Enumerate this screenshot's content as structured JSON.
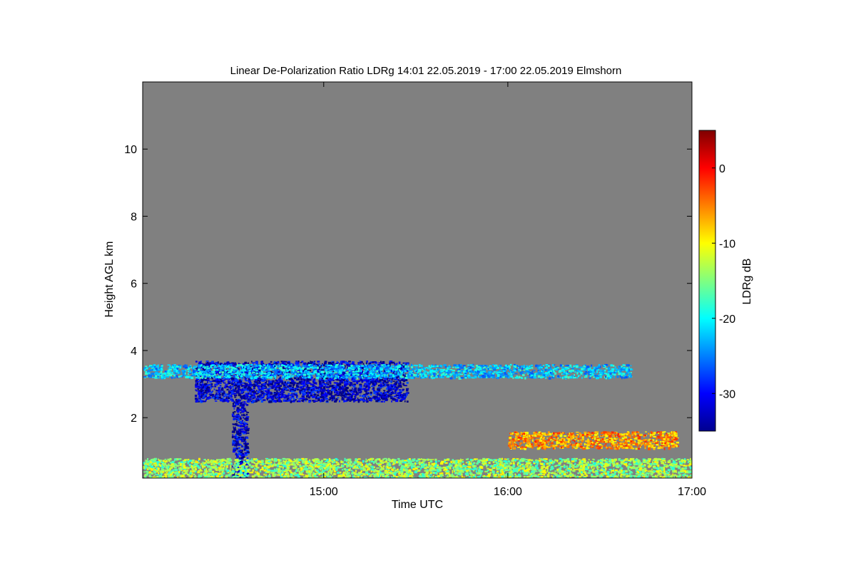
{
  "chart_data": {
    "type": "heatmap",
    "title": "Linear De-Polarization Ratio LDRg   14:01 22.05.2019 - 17:00 22.05.2019 Elmshorn",
    "xlabel": "Time UTC",
    "ylabel": "Height AGL km",
    "xlim": [
      "14:01",
      "17:00"
    ],
    "ylim": [
      0.2,
      12.0
    ],
    "x_ticks": [
      "15:00",
      "16:00",
      "17:00"
    ],
    "y_ticks": [
      "2",
      "4",
      "6",
      "8",
      "10"
    ],
    "background": "#808080",
    "colorbar": {
      "label": "LDRg dB",
      "range": [
        -35,
        5
      ],
      "ticks": [
        "0",
        "-10",
        "-20",
        "-30"
      ],
      "colormap": "jet"
    },
    "features": [
      {
        "value_dB": -32,
        "time": [
          "14:18",
          "15:27"
        ],
        "height_km": [
          2.5,
          3.7
        ]
      },
      {
        "value_dB": -32,
        "time": [
          "14:30",
          "14:35"
        ],
        "height_km": [
          0.2,
          2.5
        ]
      },
      {
        "value_dB": -22,
        "time": [
          "14:01",
          "16:40"
        ],
        "height_km": [
          3.2,
          3.6
        ]
      },
      {
        "value_dB": -14,
        "time": [
          "14:01",
          "17:00"
        ],
        "height_km": [
          0.2,
          0.8
        ]
      },
      {
        "value_dB": -6,
        "time": [
          "16:00",
          "16:55"
        ],
        "height_km": [
          1.1,
          1.6
        ]
      }
    ]
  }
}
